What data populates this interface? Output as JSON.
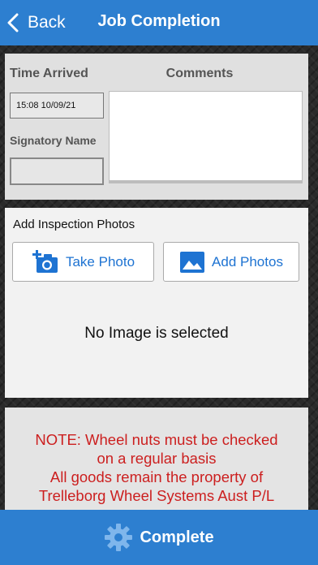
{
  "header": {
    "back_label": "Back",
    "title": "Job Completion"
  },
  "details": {
    "time_arrived_label": "Time Arrived",
    "time_arrived_value": "15:08 10/09/21",
    "comments_label": "Comments",
    "comments_value": "",
    "signatory_label": "Signatory Name",
    "signatory_value": ""
  },
  "photos": {
    "heading": "Add Inspection Photos",
    "take_photo_label": "Take Photo",
    "add_photos_label": "Add Photos",
    "empty_state": "No Image is selected"
  },
  "note": {
    "lines": [
      "NOTE: Wheel nuts must be checked",
      "on a regular basis",
      "All goods remain the property of",
      "Trelleborg Wheel Systems Aust P/L"
    ]
  },
  "footer": {
    "complete_label": "Complete"
  },
  "colors": {
    "primary": "#2d7fd0",
    "accent_text": "#1e73d2",
    "note_text": "#cc1f1f"
  }
}
